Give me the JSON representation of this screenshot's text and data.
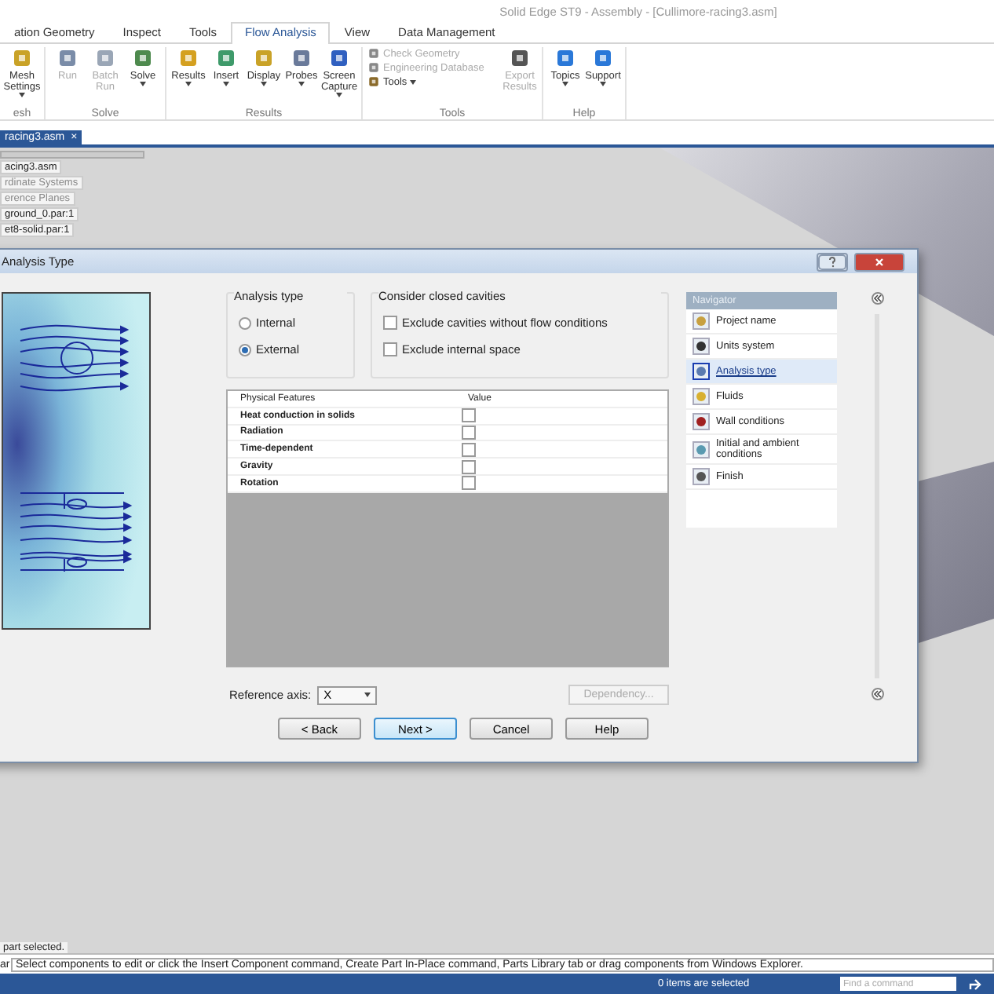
{
  "window": {
    "title": "Solid Edge ST9 - Assembly - [Cullimore-racing3.asm]"
  },
  "tabs": [
    {
      "label": "ation Geometry",
      "selected": false
    },
    {
      "label": "Inspect",
      "selected": false
    },
    {
      "label": "Tools",
      "selected": false
    },
    {
      "label": "Flow Analysis",
      "selected": true
    },
    {
      "label": "View",
      "selected": false
    },
    {
      "label": "Data Management",
      "selected": false
    }
  ],
  "ribbon": [
    {
      "label": "esh",
      "items": [
        {
          "kind": "large",
          "label": "Mesh Settings",
          "disabled": false,
          "dropdown": true
        }
      ]
    },
    {
      "label": "Solve",
      "items": [
        {
          "kind": "large",
          "label": "Run",
          "disabled": true,
          "dropdown": false
        },
        {
          "kind": "large",
          "label": "Batch Run",
          "disabled": true,
          "dropdown": false
        },
        {
          "kind": "large",
          "label": "Solve",
          "disabled": false,
          "dropdown": true
        }
      ]
    },
    {
      "label": "Results",
      "items": [
        {
          "kind": "large",
          "label": "Results",
          "disabled": false,
          "dropdown": true
        },
        {
          "kind": "large",
          "label": "Insert",
          "disabled": false,
          "dropdown": true
        },
        {
          "kind": "large",
          "label": "Display",
          "disabled": false,
          "dropdown": true
        },
        {
          "kind": "large",
          "label": "Probes",
          "disabled": false,
          "dropdown": true
        },
        {
          "kind": "large",
          "label": "Screen Capture",
          "disabled": false,
          "dropdown": true
        }
      ]
    },
    {
      "label": "Tools",
      "items": [
        {
          "kind": "small",
          "label": "Check Geometry",
          "disabled": true,
          "dropdown": false
        },
        {
          "kind": "small",
          "label": "Engineering Database",
          "disabled": true,
          "dropdown": false
        },
        {
          "kind": "small",
          "label": "Tools",
          "disabled": false,
          "dropdown": true
        },
        {
          "kind": "large",
          "label": "Export Results",
          "disabled": true,
          "dropdown": false
        }
      ]
    },
    {
      "label": "Help",
      "items": [
        {
          "kind": "large",
          "label": "Topics",
          "disabled": false,
          "dropdown": true
        },
        {
          "kind": "large",
          "label": "Support",
          "disabled": false,
          "dropdown": true
        }
      ]
    }
  ],
  "document_tab": {
    "label": "racing3.asm",
    "close": "×"
  },
  "tree": {
    "items": [
      "acing3.asm",
      "rdinate Systems",
      "erence Planes",
      "ground_0.par:1",
      "et8-solid.par:1"
    ]
  },
  "dialog": {
    "title": "Analysis Type",
    "analysis_type": {
      "label": "Analysis type",
      "options": [
        {
          "label": "Internal",
          "selected": false
        },
        {
          "label": "External",
          "selected": true
        }
      ]
    },
    "cavities": {
      "label": "Consider closed cavities",
      "options": [
        {
          "label": "Exclude cavities without flow conditions",
          "checked": false
        },
        {
          "label": "Exclude internal space",
          "checked": false
        }
      ]
    },
    "table": {
      "columns": [
        "Physical Features",
        "Value"
      ],
      "rows": [
        {
          "feature": "Heat conduction in solids",
          "checked": false
        },
        {
          "feature": "Radiation",
          "checked": false
        },
        {
          "feature": "Time-dependent",
          "checked": false
        },
        {
          "feature": "Gravity",
          "checked": false
        },
        {
          "feature": "Rotation",
          "checked": false
        }
      ]
    },
    "navigator": {
      "title": "Navigator",
      "items": [
        {
          "label": "Project name",
          "selected": false
        },
        {
          "label": "Units system",
          "selected": false
        },
        {
          "label": "Analysis type",
          "selected": true
        },
        {
          "label": "Fluids",
          "selected": false
        },
        {
          "label": "Wall conditions",
          "selected": false
        },
        {
          "label": "Initial and ambient conditions",
          "selected": false
        },
        {
          "label": "Finish",
          "selected": false
        }
      ]
    },
    "reference_axis": {
      "label": "Reference axis:",
      "value": "X"
    },
    "dependency": {
      "label": "Dependency...",
      "disabled": true
    },
    "buttons": [
      {
        "label": "< Back",
        "default": false
      },
      {
        "label": "Next >",
        "default": true
      },
      {
        "label": "Cancel",
        "default": false
      },
      {
        "label": "Help",
        "default": false
      }
    ]
  },
  "status": {
    "selection": "part selected.",
    "prompt_label": "ar",
    "prompt": "Select components to edit or click the Insert Component command, Create Part In-Place command, Parts Library tab or drag components from Windows Explorer.",
    "items_selected": "0 items are selected",
    "command_search": {
      "placeholder": "Find a command"
    }
  }
}
